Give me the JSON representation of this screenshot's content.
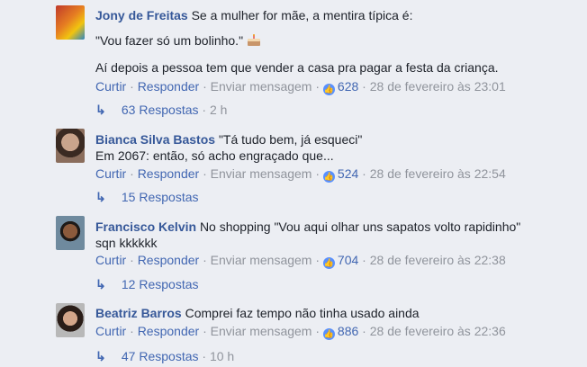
{
  "comments": [
    {
      "name": "Jony de Freitas",
      "text": "Se a mulher for mãe, a mentira típica é:",
      "lines": [
        "\"Vou fazer só um bolinho.\"",
        "Aí depois a pessoa tem que vender a casa pra pagar a festa da criança."
      ],
      "emoji": "cake-icon",
      "actions": {
        "like": "Curtir",
        "reply": "Responder",
        "message": "Enviar mensagem",
        "likes": "628",
        "date": "28 de fevereiro às 23:01"
      },
      "replies": {
        "label": "63 Respostas",
        "time": "2 h"
      }
    },
    {
      "name": "Bianca Silva Bastos",
      "text": "\"Tá tudo bem, já esqueci\"",
      "lines": [
        "Em 2067: então, só acho engraçado que..."
      ],
      "actions": {
        "like": "Curtir",
        "reply": "Responder",
        "message": "Enviar mensagem",
        "likes": "524",
        "date": "28 de fevereiro às 22:54"
      },
      "replies": {
        "label": "15 Respostas",
        "time": ""
      }
    },
    {
      "name": "Francisco Kelvin",
      "text": "No shopping \"Vou aqui olhar uns sapatos volto rapidinho\"",
      "lines": [
        "sqn kkkkkk"
      ],
      "actions": {
        "like": "Curtir",
        "reply": "Responder",
        "message": "Enviar mensagem",
        "likes": "704",
        "date": "28 de fevereiro às 22:38"
      },
      "replies": {
        "label": "12 Respostas",
        "time": ""
      }
    },
    {
      "name": "Beatriz Barros",
      "text": "Comprei faz tempo não tinha usado ainda",
      "lines": [],
      "actions": {
        "like": "Curtir",
        "reply": "Responder",
        "message": "Enviar mensagem",
        "likes": "886",
        "date": "28 de fevereiro às 22:36"
      },
      "replies": {
        "label": "47 Respostas",
        "time": "10 h"
      }
    }
  ],
  "separators": {
    "dot": "·"
  },
  "colors": {
    "name": "#365899",
    "link": "#4267b2",
    "muted": "#90949c",
    "background": "#eceef3",
    "like_badge": "#5890ff"
  }
}
